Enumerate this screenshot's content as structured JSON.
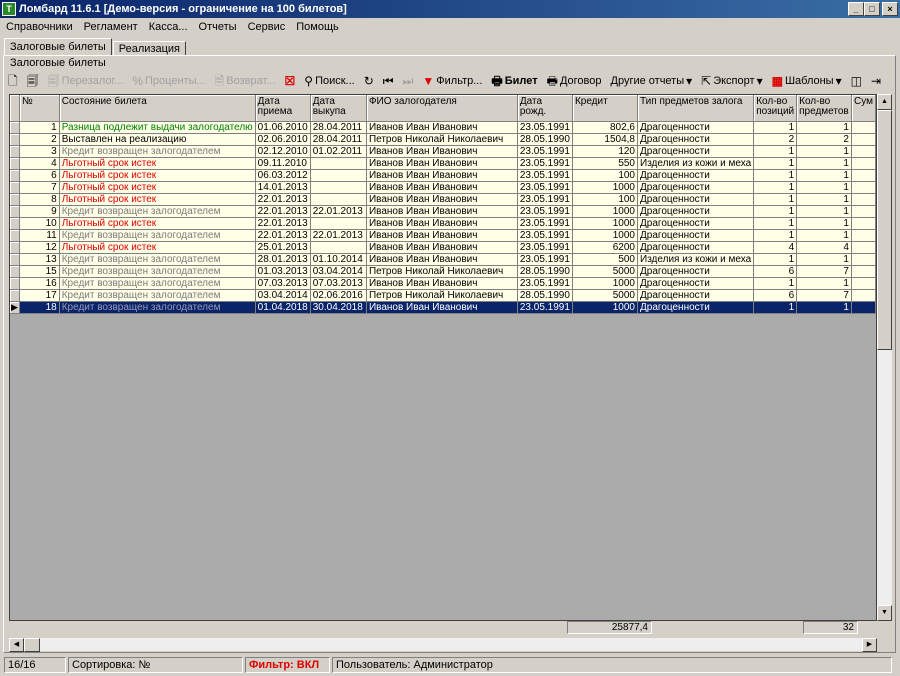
{
  "window": {
    "title": "Ломбард 11.6.1  [Демо-версия - ограничение на 100 билетов]",
    "app_icon": "Т",
    "controls": [
      "_",
      "□",
      "×"
    ]
  },
  "menu": [
    "Справочники",
    "Регламент",
    "Касса...",
    "Отчеты",
    "Сервис",
    "Помощь"
  ],
  "tabs": [
    {
      "label": "Залоговые билеты",
      "active": true
    },
    {
      "label": "Реализация",
      "active": false
    }
  ],
  "group_label": "Залоговые билеты",
  "toolbar": {
    "new_icon": "new-document-icon",
    "copy_icon": "copy-document-icon",
    "pereзalog": "Перезалог...",
    "percents": "Проценты...",
    "return": "Возврат...",
    "delete_icon": "delete-icon",
    "search": "Поиск...",
    "filter": "Фильтр...",
    "ticket": "Билет",
    "contract": "Договор",
    "other_reports": "Другие отчеты",
    "export": "Экспорт",
    "templates": "Шаблоны"
  },
  "columns": [
    "№",
    "Состояние билета",
    "Дата приема",
    "Дата выкупа",
    "ФИО залогодателя",
    "Дата рожд.",
    "Кредит",
    "Тип предметов залога",
    "Кол-во позиций",
    "Кол-во предметов",
    "Сум"
  ],
  "rows": [
    {
      "n": "1",
      "state": "Разница подлежит выдачи залогодателю",
      "color": "green",
      "date_in": "01.06.2010",
      "date_out": "28.04.2011",
      "name": "Иванов Иван Иванович",
      "birth": "23.05.1991",
      "credit": "802,6",
      "type": "Драгоценности",
      "positions": "1",
      "items": "1"
    },
    {
      "n": "2",
      "state": "Выставлен на реализацию",
      "color": "black",
      "date_in": "02.06.2010",
      "date_out": "28.04.2011",
      "name": "Петров Николай Николаевич",
      "birth": "28.05.1990",
      "credit": "1504,8",
      "type": "Драгоценности",
      "positions": "2",
      "items": "2"
    },
    {
      "n": "3",
      "state": "Кредит возвращен залогодателем",
      "color": "gray",
      "date_in": "02.12.2010",
      "date_out": "01.02.2011",
      "name": "Иванов Иван Иванович",
      "birth": "23.05.1991",
      "credit": "120",
      "type": "Драгоценности",
      "positions": "1",
      "items": "1"
    },
    {
      "n": "4",
      "state": "Льготный срок истек",
      "color": "red",
      "date_in": "09.11.2010",
      "date_out": "",
      "name": "Иванов Иван Иванович",
      "birth": "23.05.1991",
      "credit": "550",
      "type": "Изделия из кожи и меха",
      "positions": "1",
      "items": "1"
    },
    {
      "n": "6",
      "state": "Льготный срок истек",
      "color": "red",
      "date_in": "06.03.2012",
      "date_out": "",
      "name": "Иванов Иван Иванович",
      "birth": "23.05.1991",
      "credit": "100",
      "type": "Драгоценности",
      "positions": "1",
      "items": "1"
    },
    {
      "n": "7",
      "state": "Льготный срок истек",
      "color": "red",
      "date_in": "14.01.2013",
      "date_out": "",
      "name": "Иванов Иван Иванович",
      "birth": "23.05.1991",
      "credit": "1000",
      "type": "Драгоценности",
      "positions": "1",
      "items": "1"
    },
    {
      "n": "8",
      "state": "Льготный срок истек",
      "color": "red",
      "date_in": "22.01.2013",
      "date_out": "",
      "name": "Иванов Иван Иванович",
      "birth": "23.05.1991",
      "credit": "100",
      "type": "Драгоценности",
      "positions": "1",
      "items": "1"
    },
    {
      "n": "9",
      "state": "Кредит возвращен залогодателем",
      "color": "gray",
      "date_in": "22.01.2013",
      "date_out": "22.01.2013",
      "name": "Иванов Иван Иванович",
      "birth": "23.05.1991",
      "credit": "1000",
      "type": "Драгоценности",
      "positions": "1",
      "items": "1"
    },
    {
      "n": "10",
      "state": "Льготный срок истек",
      "color": "red",
      "date_in": "22.01.2013",
      "date_out": "",
      "name": "Иванов Иван Иванович",
      "birth": "23.05.1991",
      "credit": "1000",
      "type": "Драгоценности",
      "positions": "1",
      "items": "1"
    },
    {
      "n": "11",
      "state": "Кредит возвращен залогодателем",
      "color": "gray",
      "date_in": "22.01.2013",
      "date_out": "22.01.2013",
      "name": "Иванов Иван Иванович",
      "birth": "23.05.1991",
      "credit": "1000",
      "type": "Драгоценности",
      "positions": "1",
      "items": "1"
    },
    {
      "n": "12",
      "state": "Льготный срок истек",
      "color": "red",
      "date_in": "25.01.2013",
      "date_out": "",
      "name": "Иванов Иван Иванович",
      "birth": "23.05.1991",
      "credit": "6200",
      "type": "Драгоценности",
      "positions": "4",
      "items": "4"
    },
    {
      "n": "13",
      "state": "Кредит возвращен залогодателем",
      "color": "gray",
      "date_in": "28.01.2013",
      "date_out": "01.10.2014",
      "name": "Иванов Иван Иванович",
      "birth": "23.05.1991",
      "credit": "500",
      "type": "Изделия из кожи и меха",
      "positions": "1",
      "items": "1"
    },
    {
      "n": "15",
      "state": "Кредит возвращен залогодателем",
      "color": "gray",
      "date_in": "01.03.2013",
      "date_out": "03.04.2014",
      "name": "Петров Николай Николаевич",
      "birth": "28.05.1990",
      "credit": "5000",
      "type": "Драгоценности",
      "positions": "6",
      "items": "7"
    },
    {
      "n": "16",
      "state": "Кредит возвращен залогодателем",
      "color": "gray",
      "date_in": "07.03.2013",
      "date_out": "07.03.2013",
      "name": "Иванов Иван Иванович",
      "birth": "23.05.1991",
      "credit": "1000",
      "type": "Драгоценности",
      "positions": "1",
      "items": "1"
    },
    {
      "n": "17",
      "state": "Кредит возвращен залогодателем",
      "color": "gray",
      "date_in": "03.04.2014",
      "date_out": "02.06.2016",
      "name": "Петров Николай Николаевич",
      "birth": "28.05.1990",
      "credit": "5000",
      "type": "Драгоценности",
      "positions": "6",
      "items": "7"
    },
    {
      "n": "18",
      "state": "Кредит возвращен залогодателем",
      "color": "gray",
      "date_in": "01.04.2018",
      "date_out": "30.04.2018",
      "name": "Иванов Иван Иванович",
      "birth": "23.05.1991",
      "credit": "1000",
      "type": "Драгоценности",
      "positions": "1",
      "items": "1",
      "selected": true
    }
  ],
  "totals": {
    "credit": "25877,4",
    "items": "32"
  },
  "status": {
    "count": "16/16",
    "sort": "Сортировка: №",
    "filter": "Фильтр: ВКЛ",
    "user": "Пользователь: Администратор"
  }
}
